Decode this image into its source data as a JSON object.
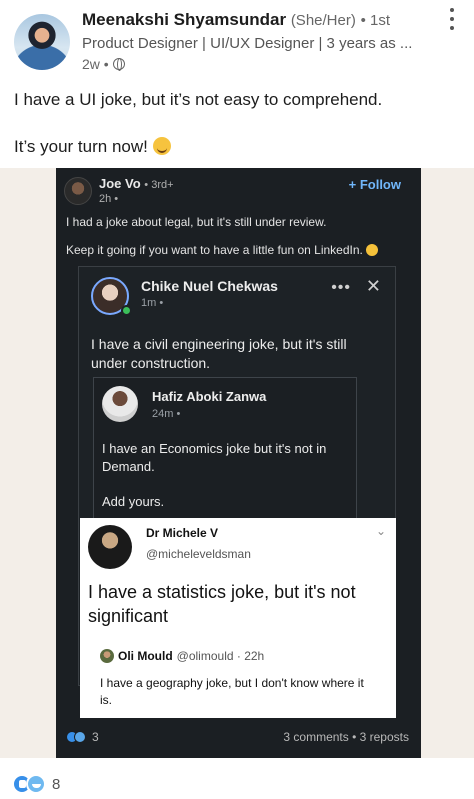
{
  "post": {
    "author_name": "Meenakshi Shyamsundar",
    "author_pronouns": "(She/Her)",
    "author_degree": "• 1st",
    "author_headline": "Product Designer | UI/UX Designer | 3 years as ...",
    "time": "2w •",
    "text_line1": "I have a UI joke, but it’s not easy to comprehend.",
    "text_line2": "It’s your turn now!",
    "reactions_count": "8"
  },
  "shared_image": {
    "joe": {
      "name": "Joe Vo",
      "degree": "• 3rd+",
      "time": "2h •",
      "follow_label": "+ Follow",
      "text1": "I had a joke about legal, but it's still under review.",
      "text2": "Keep it going if you want to have a little fun on LinkedIn."
    },
    "chike": {
      "name": "Chike Nuel Chekwas",
      "time": "1m •",
      "dots": "•••",
      "close": "✕",
      "text": "I have a civil engineering joke, but it's still under construction."
    },
    "hafiz": {
      "name": "Hafiz Aboki Zanwa",
      "time": "24m •",
      "text": "I have an Economics joke but it's not in Demand.",
      "add": "Add yours."
    },
    "tweet": {
      "name": "Dr Michele V",
      "handle": "@micheleveldsman",
      "text": "I have a statistics joke, but it's not significant",
      "quote_name": "Oli Mould",
      "quote_handle": "@olimould · 22h",
      "quote_text": "I have a geography joke, but I don't know where it is."
    },
    "footer": {
      "reactions": "3",
      "stats": "3 comments  •  3 reposts"
    }
  }
}
